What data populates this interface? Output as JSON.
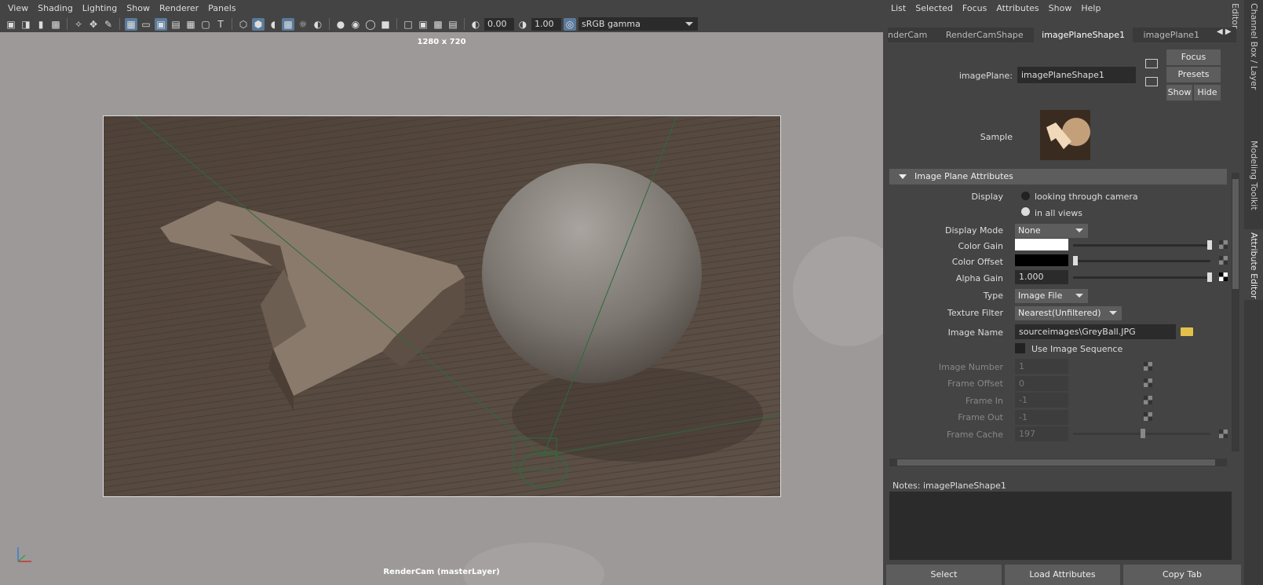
{
  "viewport": {
    "menu": [
      "View",
      "Shading",
      "Lighting",
      "Show",
      "Renderer",
      "Panels"
    ],
    "toolbar": {
      "exposure": "0.00",
      "gamma": "1.00",
      "color_space": "sRGB gamma"
    },
    "resolution_label": "1280 x 720",
    "camera_label": "RenderCam (masterLayer)"
  },
  "attribute_editor": {
    "menu": [
      "List",
      "Selected",
      "Focus",
      "Attributes",
      "Show",
      "Help"
    ],
    "tabs": [
      "nderCam",
      "RenderCamShape",
      "imagePlaneShape1",
      "imagePlane1"
    ],
    "active_tab": 2,
    "node_label": "imagePlane:",
    "node_name": "imagePlaneShape1",
    "buttons": {
      "focus": "Focus",
      "presets": "Presets",
      "show": "Show",
      "hide": "Hide"
    },
    "sample_label": "Sample",
    "section_title": "Image Plane Attributes",
    "display": {
      "label": "Display",
      "opt1": "looking through camera",
      "opt2": "in all views",
      "selected": 2
    },
    "display_mode": {
      "label": "Display Mode",
      "value": "None"
    },
    "color_gain": {
      "label": "Color Gain",
      "color": "#ffffff",
      "slider": 1.0
    },
    "color_offset": {
      "label": "Color Offset",
      "color": "#000000",
      "slider": 0.0
    },
    "alpha_gain": {
      "label": "Alpha Gain",
      "value": "1.000",
      "slider": 1.0
    },
    "type": {
      "label": "Type",
      "value": "Image File"
    },
    "texture_filter": {
      "label": "Texture Filter",
      "value": "Nearest(Unfiltered)"
    },
    "image_name": {
      "label": "Image Name",
      "value": "sourceimages\\GreyBall.JPG"
    },
    "use_image_sequence": "Use Image Sequence",
    "image_number": {
      "label": "Image Number",
      "value": "1"
    },
    "frame_offset": {
      "label": "Frame Offset",
      "value": "0"
    },
    "frame_in": {
      "label": "Frame In",
      "value": "-1"
    },
    "frame_out": {
      "label": "Frame Out",
      "value": "-1"
    },
    "frame_cache": {
      "label": "Frame Cache",
      "value": "197"
    },
    "notes_label": "Notes:  imagePlaneShape1",
    "bottom_buttons": [
      "Select",
      "Load Attributes",
      "Copy Tab"
    ]
  },
  "side_tabs": [
    "Channel Box / Layer Editor",
    "Modeling Toolkit",
    "Attribute Editor"
  ]
}
